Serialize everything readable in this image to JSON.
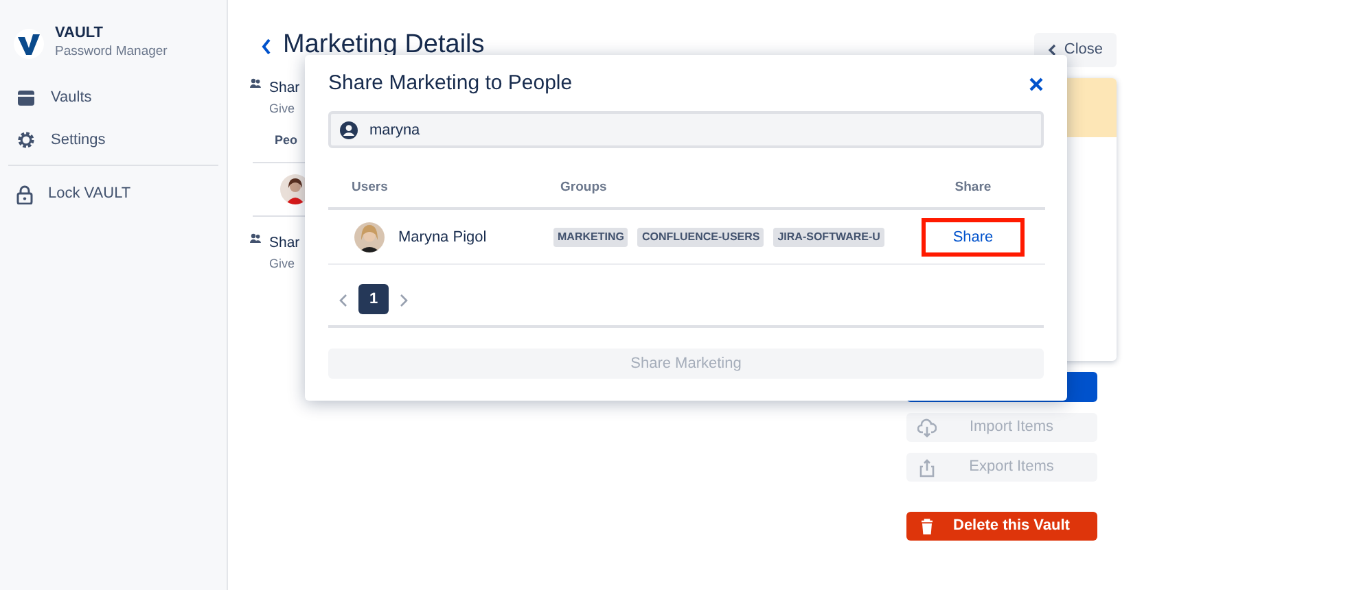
{
  "sidebar": {
    "app_name": "VAULT",
    "app_subtitle": "Password Manager",
    "items": [
      {
        "label": "Vaults",
        "kind": "vaults"
      },
      {
        "label": "Settings",
        "kind": "settings"
      }
    ],
    "lock_item": {
      "label": "Lock VAULT"
    }
  },
  "page": {
    "title": "Marketing Details",
    "close_button": "Close",
    "sections": [
      {
        "title": "Shar",
        "subtitle": "Give",
        "column_header": "Peo"
      },
      {
        "title": "Shar",
        "subtitle": "Give"
      }
    ],
    "actions": [
      {
        "label": "Import Items",
        "kind": "import",
        "disabled": true
      },
      {
        "label": "Export Items",
        "kind": "export",
        "disabled": true
      },
      {
        "label": "Delete this Vault",
        "kind": "delete",
        "disabled": false
      }
    ]
  },
  "modal": {
    "title": "Share Marketing to People",
    "search": {
      "value": "maryna"
    },
    "columns": [
      "Users",
      "Groups",
      "Share"
    ],
    "rows": [
      {
        "name": "Maryna Pigol",
        "groups": [
          "MARKETING",
          "CONFLUENCE-USERS",
          "JIRA-SOFTWARE-U"
        ],
        "action": "Share",
        "highlighted": true
      }
    ],
    "pages": [
      {
        "label": "1",
        "selected": true
      }
    ],
    "submit": {
      "label": "Share Marketing",
      "disabled": true
    }
  }
}
